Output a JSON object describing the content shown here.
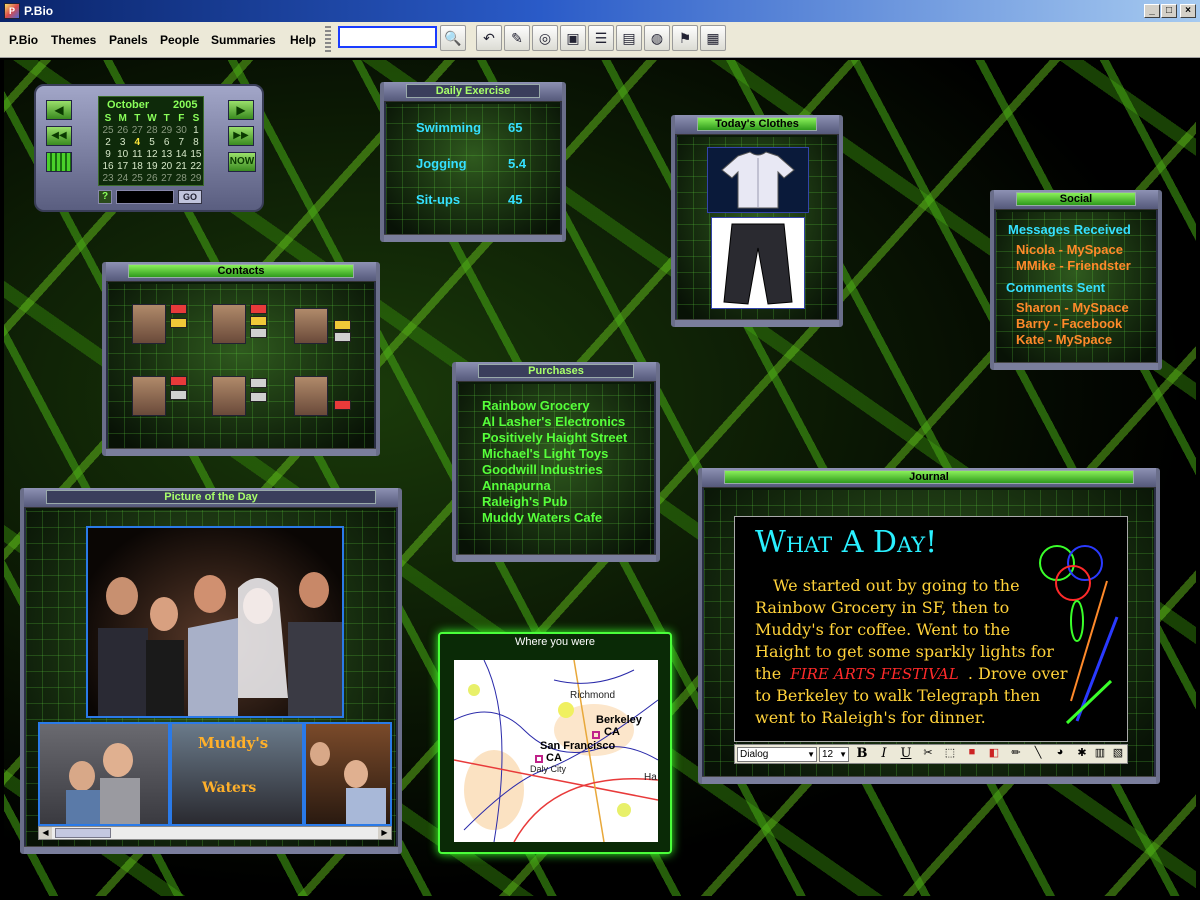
{
  "window": {
    "title": "P.Bio",
    "app_icon": "pbio-app-icon",
    "controls": [
      "_",
      "□",
      "×"
    ]
  },
  "menu": [
    "P.Bio",
    "Themes",
    "Panels",
    "People",
    "Summaries",
    "Help"
  ],
  "search": {
    "value": "",
    "placeholder": ""
  },
  "toolbar_icons": [
    "search-icon",
    "undo-icon",
    "eraser-icon",
    "disc-icon",
    "save-icon",
    "list-icon",
    "notes-icon",
    "globe-icon",
    "flag-icon",
    "image-icon"
  ],
  "calendar": {
    "month": "October",
    "year": "2005",
    "days_header": [
      "S",
      "M",
      "T",
      "W",
      "T",
      "F",
      "S"
    ],
    "rows": [
      [
        "25",
        "26",
        "27",
        "28",
        "29",
        "30",
        "1"
      ],
      [
        "2",
        "3",
        "4",
        "5",
        "6",
        "7",
        "8"
      ],
      [
        "9",
        "10",
        "11",
        "12",
        "13",
        "14",
        "15"
      ],
      [
        "16",
        "17",
        "18",
        "19",
        "20",
        "21",
        "22"
      ],
      [
        "23",
        "24",
        "25",
        "26",
        "27",
        "28",
        "29"
      ]
    ],
    "today": "4",
    "now_label": "NOW",
    "help_label": "?",
    "go_label": "GO",
    "input_value": ""
  },
  "exercise": {
    "title": "Daily Exercise",
    "items": [
      {
        "name": "Swimming",
        "value": "65"
      },
      {
        "name": "Jogging",
        "value": "5.4"
      },
      {
        "name": "Sit-ups",
        "value": "45"
      }
    ]
  },
  "clothes": {
    "title": "Today's Clothes",
    "items": [
      "shirt-image",
      "pants-image"
    ]
  },
  "social": {
    "title": "Social",
    "received_label": "Messages Received",
    "received": [
      "Nicola - MySpace",
      "MMike - Friendster"
    ],
    "sent_label": "Comments Sent",
    "sent": [
      "Sharon - MySpace",
      "Barry - Facebook",
      "Kate - MySpace"
    ]
  },
  "contacts": {
    "title": "Contacts",
    "count": 6
  },
  "purchases": {
    "title": "Purchases",
    "items": [
      "Rainbow Grocery",
      "Al Lasher's Electronics",
      "Positively Haight Street",
      "Michael's Light Toys",
      "Goodwill Industries",
      "Annapurna",
      "Raleigh's Pub",
      "Muddy Waters Cafe"
    ]
  },
  "picture": {
    "title": "Picture of the Day",
    "sign_text_1": "Muddy's",
    "sign_text_2": "Waters"
  },
  "map": {
    "title": "Where you were",
    "labels": [
      "Richmond",
      "Berkeley",
      "CA",
      "San Francisco",
      "CA",
      "Daly City",
      "Ha"
    ]
  },
  "journal": {
    "title": "Journal",
    "heading": "What A Day!",
    "text_before": "We started out by going to the Rainbow Grocery in SF, then to Muddy's for coffee. Went to the Haight to get some sparkly lights for the",
    "highlight": "FIRE ARTS FESTIVAL",
    "text_after": ". Drove over to Berkeley to walk Telegraph then went to Raleigh's for dinner.",
    "font_name": "Dialog",
    "font_size": "12",
    "format_buttons": [
      "B",
      "I",
      "U"
    ]
  },
  "colors": {
    "accent_green": "#56ff3a",
    "cyan": "#35e0ff",
    "orange": "#ff8a2a",
    "journal_text": "#ffd23a",
    "journal_heading": "#2af0ff",
    "festival": "#ff2a2a"
  }
}
